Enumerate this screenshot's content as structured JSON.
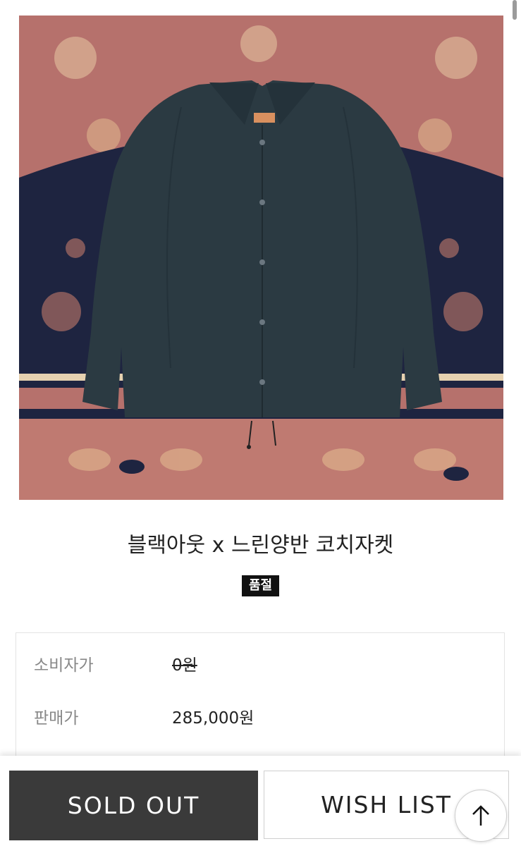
{
  "product": {
    "title": "블랙아웃 x 느린양반 코치자켓",
    "badge": "품절",
    "image_alt": "navy coach jacket on patterned rug"
  },
  "prices": [
    {
      "label": "소비자가",
      "value": "0원",
      "strikethrough": true
    },
    {
      "label": "판매가",
      "value": "285,000원",
      "strikethrough": false
    }
  ],
  "actions": {
    "sold_out_label": "SOLD OUT",
    "wish_list_label": "WISH LIST",
    "scroll_top_icon": "arrow-up-icon"
  },
  "colors": {
    "sold_out_bg": "#3a3a3a",
    "badge_bg": "#111111",
    "rug_red": "#b9706b",
    "rug_navy": "#1e2440",
    "jacket": "#2b3a42"
  }
}
